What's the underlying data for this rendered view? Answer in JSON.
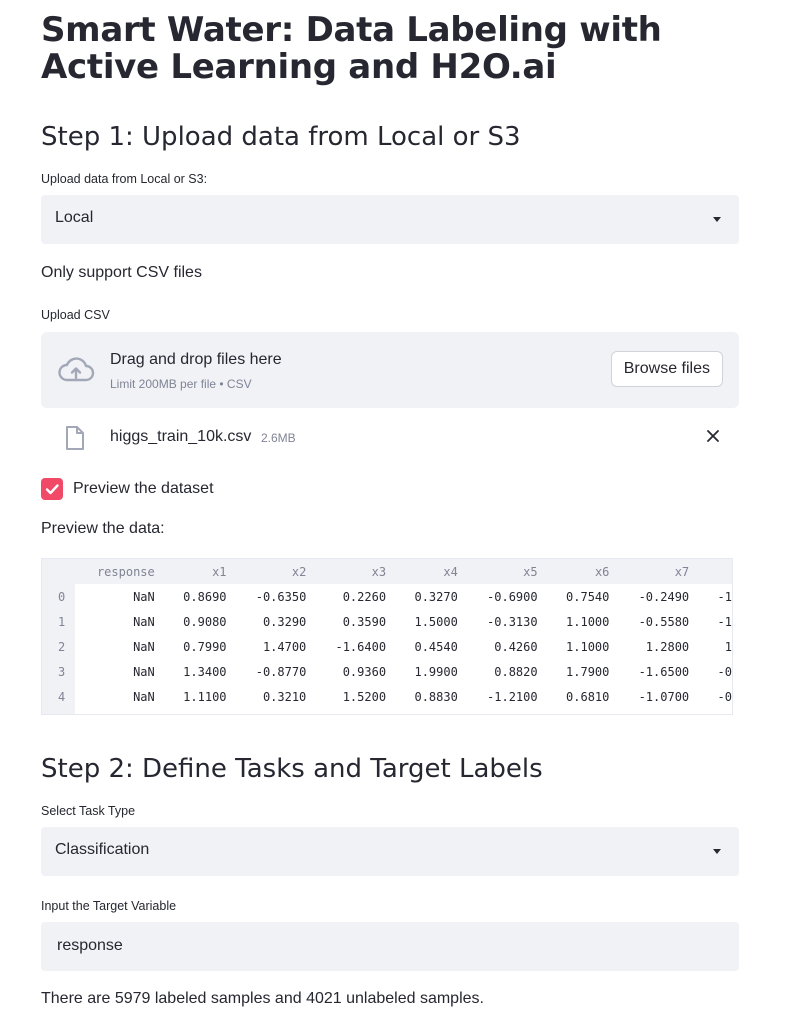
{
  "title": "Smart Water: Data Labeling with Active Learning and H2O.ai",
  "step1": {
    "heading": "Step 1: Upload data from Local or S3",
    "source_label": "Upload data from Local or S3:",
    "source_value": "Local",
    "csv_note": "Only support CSV files",
    "upload_label": "Upload CSV",
    "dropzone_title": "Drag and drop files here",
    "dropzone_limit": "Limit 200MB per file • CSV",
    "browse_label": "Browse files",
    "file_name": "higgs_train_10k.csv",
    "file_size": "2.6MB",
    "preview_checkbox_label": "Preview the dataset",
    "preview_checked": true,
    "preview_heading": "Preview the data:"
  },
  "preview_table": {
    "columns": [
      "response",
      "x1",
      "x2",
      "x3",
      "x4",
      "x5",
      "x6",
      "x7"
    ],
    "rows": [
      {
        "index": "0",
        "values": [
          "NaN",
          "0.8690",
          "-0.6350",
          "0.2260",
          "0.3270",
          "-0.6900",
          "0.7540",
          "-0.2490",
          "-1"
        ]
      },
      {
        "index": "1",
        "values": [
          "NaN",
          "0.9080",
          "0.3290",
          "0.3590",
          "1.5000",
          "-0.3130",
          "1.1000",
          "-0.5580",
          "-1"
        ]
      },
      {
        "index": "2",
        "values": [
          "NaN",
          "0.7990",
          "1.4700",
          "-1.6400",
          "0.4540",
          "0.4260",
          "1.1000",
          "1.2800",
          "1"
        ]
      },
      {
        "index": "3",
        "values": [
          "NaN",
          "1.3400",
          "-0.8770",
          "0.9360",
          "1.9900",
          "0.8820",
          "1.7900",
          "-1.6500",
          "-0"
        ]
      },
      {
        "index": "4",
        "values": [
          "NaN",
          "1.1100",
          "0.3210",
          "1.5200",
          "0.8830",
          "-1.2100",
          "0.6810",
          "-1.0700",
          "-0"
        ]
      }
    ]
  },
  "step2": {
    "heading": "Step 2: Define Tasks and Target Labels",
    "task_label": "Select Task Type",
    "task_value": "Classification",
    "target_label": "Input the Target Variable",
    "target_value": "response",
    "summary": "There are 5979 labeled samples and 4021 unlabeled samples."
  },
  "colors": {
    "accent": "#f14a68",
    "widget_bg": "#f0f2f6",
    "text": "#262730",
    "muted": "#808495"
  },
  "icons": {
    "upload": "cloud-upload-icon",
    "file": "file-icon",
    "remove": "close-icon",
    "check": "check-icon",
    "dropdown": "chevron-down-icon"
  }
}
